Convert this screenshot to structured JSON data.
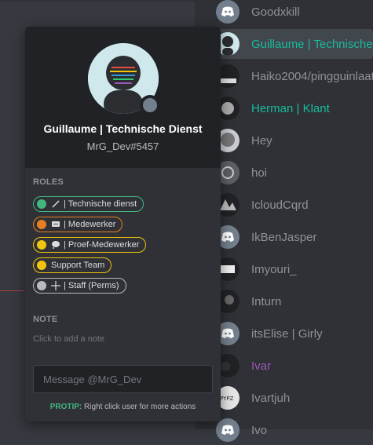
{
  "popout": {
    "username": "Guillaume | Technische Dienst",
    "tag": "MrG_Dev#5457",
    "status_color": "#747f8d",
    "roles_title": "ROLES",
    "roles": [
      {
        "label": "| Technische dienst",
        "color": "#43b581",
        "icon": "wand-icon"
      },
      {
        "label": "| Medewerker",
        "color": "#e67e22",
        "icon": "speech-bubble-icon"
      },
      {
        "label": "| Proef-Medewerker",
        "color": "#f1c40f",
        "icon": "thought-bubble-icon"
      },
      {
        "label": "Support Team",
        "color": "#f1c40f",
        "icon": ""
      },
      {
        "label": "| Staff (Perms)",
        "color": "#b9bbbe",
        "icon": "crosshair-icon"
      }
    ],
    "note_title": "NOTE",
    "note_placeholder": "Click to add a note",
    "message_placeholder": "Message @MrG_Dev",
    "protip_label": "PROTIP:",
    "protip_text": "Right click user for more actions"
  },
  "members": [
    {
      "name": "Goodxkill",
      "color": "#8e9297",
      "avatar": "discord-logo"
    },
    {
      "name": "Guillaume | Technische Dienst",
      "color": "#1abc9c",
      "avatar": "profile-photo",
      "selected": true
    },
    {
      "name": "Haiko2004/pingguinlaat",
      "color": "#8e9297",
      "avatar": "profile-photo"
    },
    {
      "name": "Herman | Klant",
      "color": "#1abc9c",
      "avatar": "profile-photo"
    },
    {
      "name": "Hey",
      "color": "#8e9297",
      "avatar": "profile-photo"
    },
    {
      "name": "hoi",
      "color": "#8e9297",
      "avatar": "profile-photo"
    },
    {
      "name": "IcloudCqrd",
      "color": "#8e9297",
      "avatar": "profile-photo"
    },
    {
      "name": "IkBenJasper",
      "color": "#8e9297",
      "avatar": "discord-logo"
    },
    {
      "name": "Imyouri_",
      "color": "#8e9297",
      "avatar": "profile-photo"
    },
    {
      "name": "Inturn",
      "color": "#8e9297",
      "avatar": "profile-photo"
    },
    {
      "name": "itsElise | Girly",
      "color": "#8e9297",
      "avatar": "discord-logo"
    },
    {
      "name": "Ivar",
      "color": "#9b59b6",
      "avatar": "profile-photo"
    },
    {
      "name": "Ivartjuh",
      "color": "#8e9297",
      "avatar": "profile-photo"
    },
    {
      "name": "Ivo",
      "color": "#8e9297",
      "avatar": "discord-logo"
    }
  ]
}
